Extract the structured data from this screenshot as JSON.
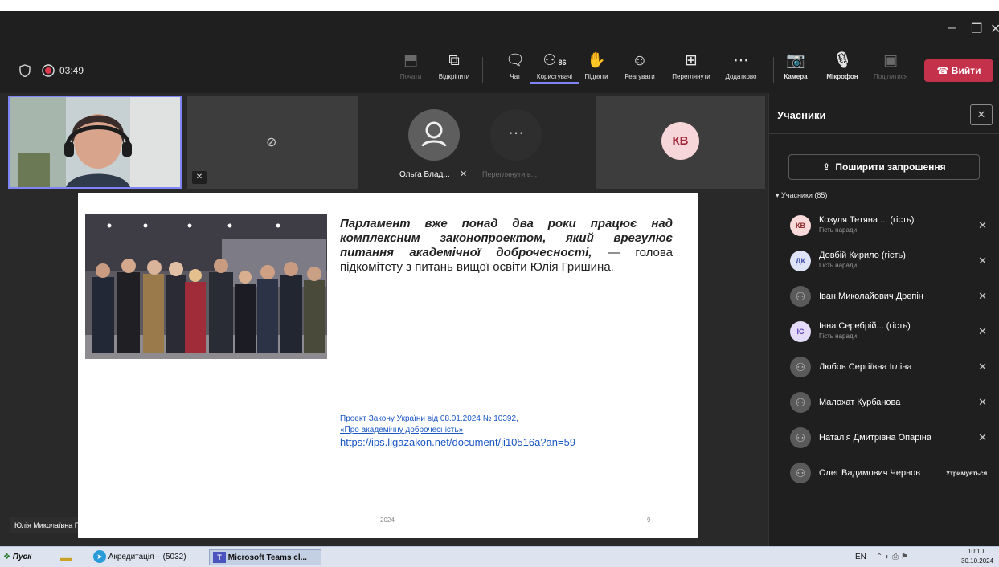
{
  "window": {
    "minimize": "–",
    "restore": "❐",
    "close": "✕"
  },
  "meeting": {
    "timer": "03:49"
  },
  "toolbar": {
    "share": "Почати",
    "popout": "Відкріпити",
    "chat": "Чат",
    "people": "Користувачі",
    "people_count": "86",
    "raise": "Підняти",
    "react": "Реагувати",
    "view": "Переглянути",
    "more": "Додатково",
    "camera": "Камера",
    "mic": "Мікрофон",
    "share_screen": "Поділитися",
    "leave": "Вийти"
  },
  "tiles": {
    "initials": "КВ",
    "name_olga": "Ольга Влад...",
    "view_more": "Переглянути в...",
    "presenter": "Юлія Миколаївна Главчева"
  },
  "slide": {
    "quote_bold": "Парламент вже понад два роки працює над комплексним законопроектом, який врегулює питання академічної доброчесності,",
    "quote_rest": " — голова підкомітету з питань вищої освіти Юлія Гришина.",
    "link1": "Проект Закону України від 08.01.2024 № 10392,",
    "link2": "«Про академічну доброчесність»",
    "link3": "https://ips.ligazakon.net/document/ji10516a?an=59",
    "year": "2024",
    "page": "9"
  },
  "panel": {
    "title": "Учасники",
    "invite": "Поширити запрошення",
    "section": "Учасники (85)",
    "participants": [
      {
        "avatar": "КВ",
        "name": "Козуля Тетяна ... (гість)",
        "sub": "Гість наради"
      },
      {
        "avatar": "ДК",
        "name": "Довбій Кирило (гість)",
        "sub": "Гість наради"
      },
      {
        "avatar": "",
        "name": "Іван Миколайович Дрепін",
        "sub": ""
      },
      {
        "avatar": "ІС",
        "name": "Інна Серебрій... (гість)",
        "sub": "Гість наради"
      },
      {
        "avatar": "",
        "name": "Любов Сергіївна Ігліна",
        "sub": ""
      },
      {
        "avatar": "",
        "name": "Малохат Курбанова",
        "sub": ""
      },
      {
        "avatar": "",
        "name": "Наталія Дмитрівна Опаріна",
        "sub": ""
      },
      {
        "avatar": "",
        "name": "Олег Вадимович Чернов",
        "sub": "",
        "status": "Утримується"
      }
    ]
  },
  "taskbar": {
    "start": "Пуск",
    "telegram": "Акредитація – (5032)",
    "teams": "Microsoft Teams cl...",
    "lang": "EN",
    "time": "10:10",
    "date": "30.10.2024"
  }
}
